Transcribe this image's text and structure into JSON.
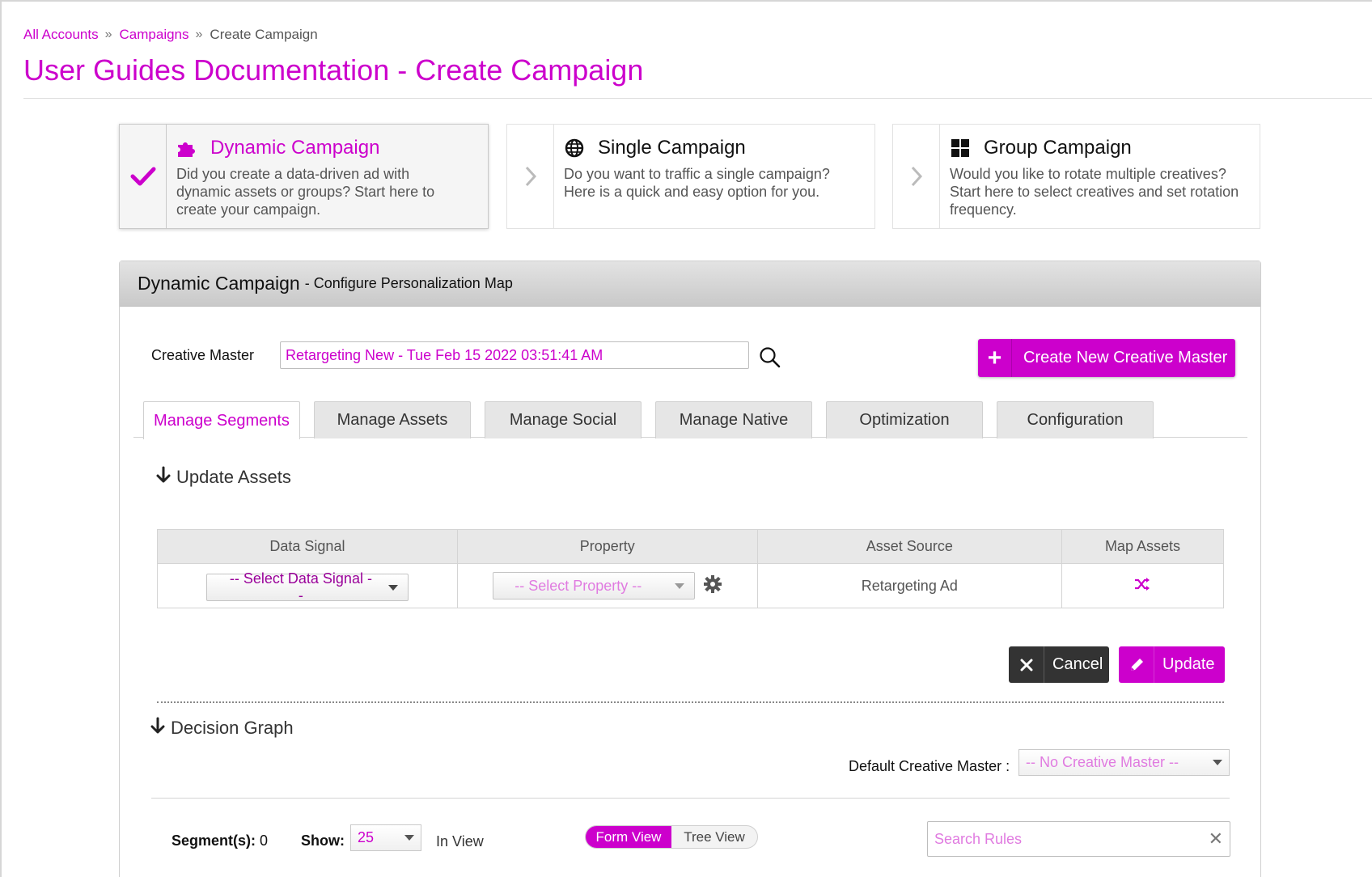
{
  "breadcrumb": {
    "items": [
      "All Accounts",
      "Campaigns",
      "Create Campaign"
    ],
    "separator": "»"
  },
  "page_title": "User Guides Documentation - Create Campaign",
  "campaign_types": [
    {
      "title": "Dynamic Campaign",
      "description": "Did you create a data-driven ad with dynamic assets or groups? Start here to create your campaign.",
      "icon": "puzzle-icon",
      "selected": true
    },
    {
      "title": "Single Campaign",
      "description": "Do you want to traffic a single campaign? Here is a quick and easy option for you.",
      "icon": "globe-icon",
      "selected": false
    },
    {
      "title": "Group Campaign",
      "description": "Would you like to rotate multiple creatives? Start here to select creatives and set rotation frequency.",
      "icon": "grid-icon",
      "selected": false
    }
  ],
  "panel": {
    "title": "Dynamic Campaign",
    "subtitle": "- Configure Personalization Map"
  },
  "creative_master": {
    "label": "Creative Master",
    "value": "Retargeting New - Tue Feb 15 2022 03:51:41 AM",
    "create_button": "Create New Creative Master"
  },
  "tabs": [
    "Manage Segments",
    "Manage Assets",
    "Manage Social",
    "Manage Native",
    "Optimization",
    "Configuration"
  ],
  "active_tab": "Manage Segments",
  "update_assets": {
    "title": "Update Assets",
    "columns": [
      "Data Signal",
      "Property",
      "Asset Source",
      "Map Assets"
    ],
    "row": {
      "data_signal": "-- Select Data Signal --",
      "property": "-- Select Property --",
      "asset_source": "Retargeting Ad"
    },
    "cancel": "Cancel",
    "update": "Update"
  },
  "decision_graph": {
    "title": "Decision Graph",
    "default_cm_label": "Default Creative Master :",
    "default_cm_value": "-- No Creative Master --",
    "segments_label": "Segment(s):",
    "segments_count": "0",
    "show_label": "Show:",
    "show_value": "25",
    "in_view": "In View",
    "views": [
      "Form View",
      "Tree View"
    ],
    "active_view": "Form View",
    "search_placeholder": "Search Rules"
  },
  "colors": {
    "accent": "#cc00cc",
    "dark_button": "#333333"
  }
}
